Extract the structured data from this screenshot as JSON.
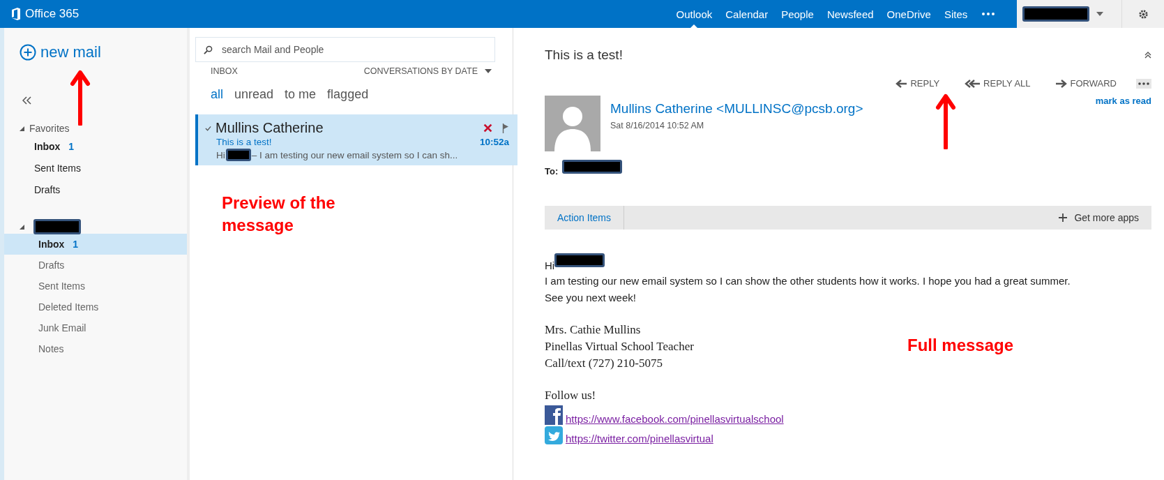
{
  "top_bar": {
    "brand": "Office 365",
    "nav": [
      {
        "label": "Outlook",
        "selected": true
      },
      {
        "label": "Calendar",
        "selected": false
      },
      {
        "label": "People",
        "selected": false
      },
      {
        "label": "Newsfeed",
        "selected": false
      },
      {
        "label": "OneDrive",
        "selected": false
      },
      {
        "label": "Sites",
        "selected": false
      }
    ]
  },
  "sidebar": {
    "new_mail": "new mail",
    "sections": [
      {
        "kind": "favorites",
        "label": "Favorites",
        "expanded": true,
        "items": [
          {
            "label": "Inbox",
            "count": "1",
            "selected": false
          },
          {
            "label": "Sent Items",
            "selected": false
          },
          {
            "label": "Drafts",
            "selected": false
          }
        ]
      },
      {
        "kind": "account",
        "expanded": true,
        "items": [
          {
            "label": "Inbox",
            "count": "1",
            "selected": true
          },
          {
            "label": "Drafts",
            "selected": false
          },
          {
            "label": "Sent Items",
            "selected": false
          },
          {
            "label": "Deleted Items",
            "selected": false
          },
          {
            "label": "Junk Email",
            "selected": false
          },
          {
            "label": "Notes",
            "selected": false
          }
        ]
      }
    ]
  },
  "message_list": {
    "search": {
      "placeholder": "search Mail and People"
    },
    "folder": "INBOX",
    "sort": "CONVERSATIONS BY DATE",
    "filters": [
      {
        "label": "all",
        "selected": true
      },
      {
        "label": "unread",
        "selected": false
      },
      {
        "label": "to me",
        "selected": false
      },
      {
        "label": "flagged",
        "selected": false
      }
    ],
    "messages": [
      {
        "sender": "Mullins Catherine",
        "subject": "This is a test!",
        "preview_start": "Hi",
        "preview_end": "– I am testing our new email system so I can sh...",
        "time": "10:52a",
        "selected": true
      }
    ]
  },
  "reading_pane": {
    "subject": "This is a test!",
    "actions": [
      {
        "label": "REPLY",
        "kind": "reply"
      },
      {
        "label": "REPLY ALL",
        "kind": "reply_all"
      },
      {
        "label": "FORWARD",
        "kind": "forward"
      }
    ],
    "sender": "Mullins Catherine <MULLINSC@pcsb.org>",
    "date": "Sat 8/16/2014 10:52 AM",
    "mark_as_read": "mark as read",
    "to_label": "To:",
    "apps_bar": {
      "tab": "Action Items",
      "more": "Get more apps"
    },
    "body": {
      "greeting": "Hi",
      "lines": [
        "I am testing our new email system so I can show the other students how it works. I hope you had a great summer.",
        "See you next week!"
      ],
      "signature": [
        "Mrs. Cathie Mullins",
        "Pinellas Virtual School Teacher",
        "Call/text (727) 210-5075"
      ],
      "follow": "Follow us!",
      "links": [
        {
          "kind": "facebook",
          "url": "https://www.facebook.com/pinellasvirtualschool"
        },
        {
          "kind": "twitter",
          "url": "https://twitter.com/pinellasvirtual"
        }
      ]
    }
  },
  "annotations": [
    {
      "kind": "preview",
      "text": "Preview of the message"
    },
    {
      "kind": "full",
      "text": "Full message"
    }
  ]
}
